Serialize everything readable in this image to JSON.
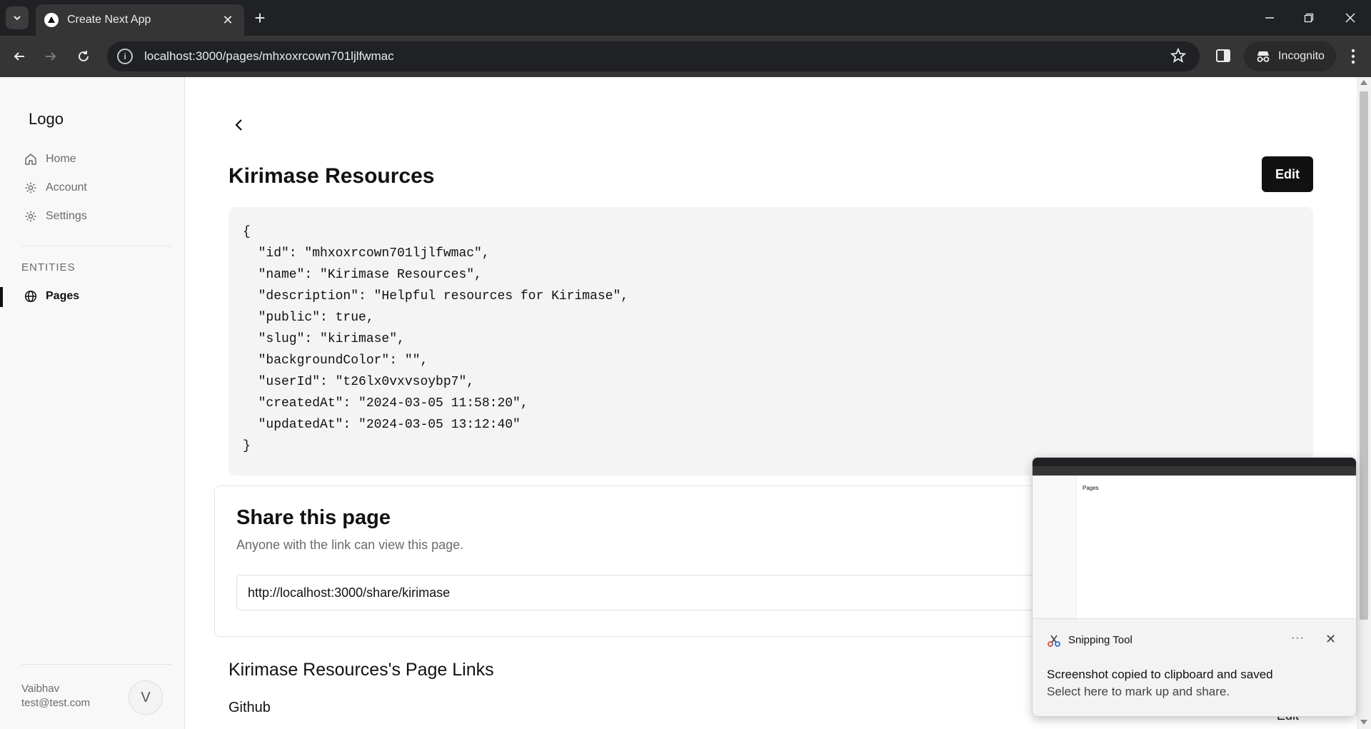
{
  "browser": {
    "tab_title": "Create Next App",
    "url": "localhost:3000/pages/mhxoxrcown701ljlfwmac",
    "incognito_label": "Incognito"
  },
  "sidebar": {
    "logo": "Logo",
    "items": [
      {
        "label": "Home",
        "icon": "home-icon"
      },
      {
        "label": "Account",
        "icon": "gear-icon"
      },
      {
        "label": "Settings",
        "icon": "gear-icon"
      }
    ],
    "entities_label": "ENTITIES",
    "entity_items": [
      {
        "label": "Pages",
        "icon": "globe-icon",
        "active": true
      }
    ],
    "user": {
      "name": "Vaibhav",
      "email": "test@test.com",
      "avatar_initial": "V"
    }
  },
  "main": {
    "title": "Kirimase Resources",
    "edit_label": "Edit",
    "json_lines": [
      "{",
      "  \"id\": \"mhxoxrcown701ljlfwmac\",",
      "  \"name\": \"Kirimase Resources\",",
      "  \"description\": \"Helpful resources for Kirimase\",",
      "  \"public\": true,",
      "  \"slug\": \"kirimase\",",
      "  \"backgroundColor\": \"\",",
      "  \"userId\": \"t26lx0vxvsoybp7\",",
      "  \"createdAt\": \"2024-03-05 11:58:20\",",
      "  \"updatedAt\": \"2024-03-05 13:12:40\"",
      "}"
    ],
    "share": {
      "title": "Share this page",
      "subtitle": "Anyone with the link can view this page.",
      "link": "http://localhost:3000/share/kirimase"
    },
    "links_title": "Kirimase Resources's Page Links",
    "links": [
      {
        "label": "Github",
        "edit_label": "Edit"
      }
    ]
  },
  "toast": {
    "app_name": "Snipping Tool",
    "more": "···",
    "close": "✕",
    "message": "Screenshot copied to clipboard and saved",
    "sub_message": "Select here to mark up and share.",
    "thumb_title": "Pages"
  },
  "colors": {
    "chrome_dark": "#202124",
    "chrome_toolbar": "#353535",
    "accent": "#111111",
    "sidebar_bg": "#f8f8f8",
    "code_bg": "#f4f4f4"
  }
}
